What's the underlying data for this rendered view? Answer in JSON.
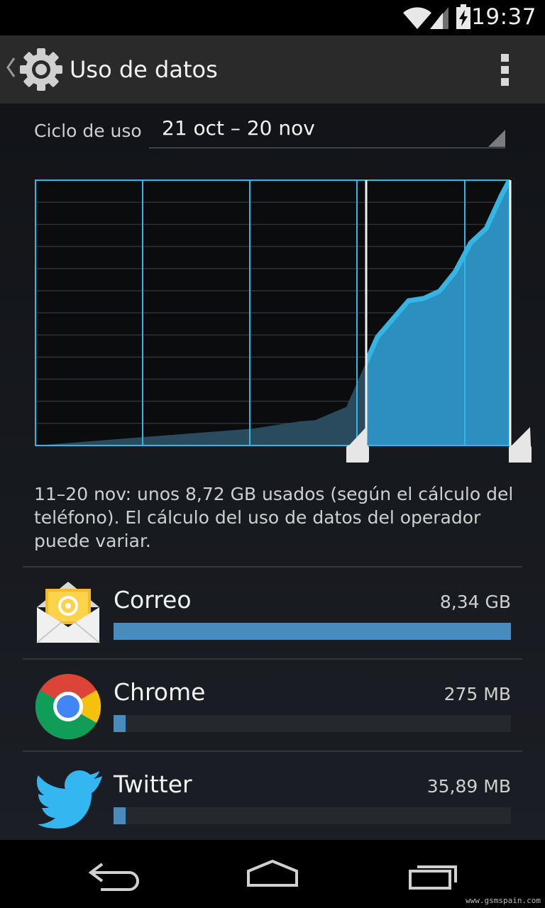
{
  "status_bar": {
    "time": "19:37"
  },
  "action_bar": {
    "title": "Uso de datos"
  },
  "cycle": {
    "label": "Ciclo de uso",
    "value": "21 oct – 20 nov"
  },
  "chart_data": {
    "type": "area",
    "series": [
      {
        "x": [
          0,
          2,
          4,
          6,
          8,
          10,
          12,
          14,
          16,
          17,
          18,
          20,
          22,
          24,
          25,
          26,
          27,
          28,
          29,
          30,
          30.5
        ],
        "values": [
          0,
          0.1,
          0.2,
          0.3,
          0.4,
          0.5,
          0.6,
          0.7,
          0.9,
          1.0,
          1.05,
          1.6,
          4.5,
          6.0,
          6.1,
          6.4,
          7.2,
          8.4,
          9.0,
          10.4,
          11.0
        ]
      }
    ],
    "selection": {
      "start": "11 nov",
      "end": "20 nov"
    },
    "grid": true
  },
  "summary": "11–20 nov: unos 8,72 GB usados (según el cálculo del teléfono). El cálculo del uso de datos del operador puede variar.",
  "apps": [
    {
      "name": "Correo",
      "usage": "8,34 GB",
      "fraction": 1.0
    },
    {
      "name": "Chrome",
      "usage": "275 MB",
      "fraction": 0.03
    },
    {
      "name": "Twitter",
      "usage": "35,89 MB",
      "fraction": 0.004
    }
  ],
  "watermark": "www.gsmspain.com",
  "colors": {
    "accent": "#33b5e5",
    "bar": "#4a8bbe"
  }
}
